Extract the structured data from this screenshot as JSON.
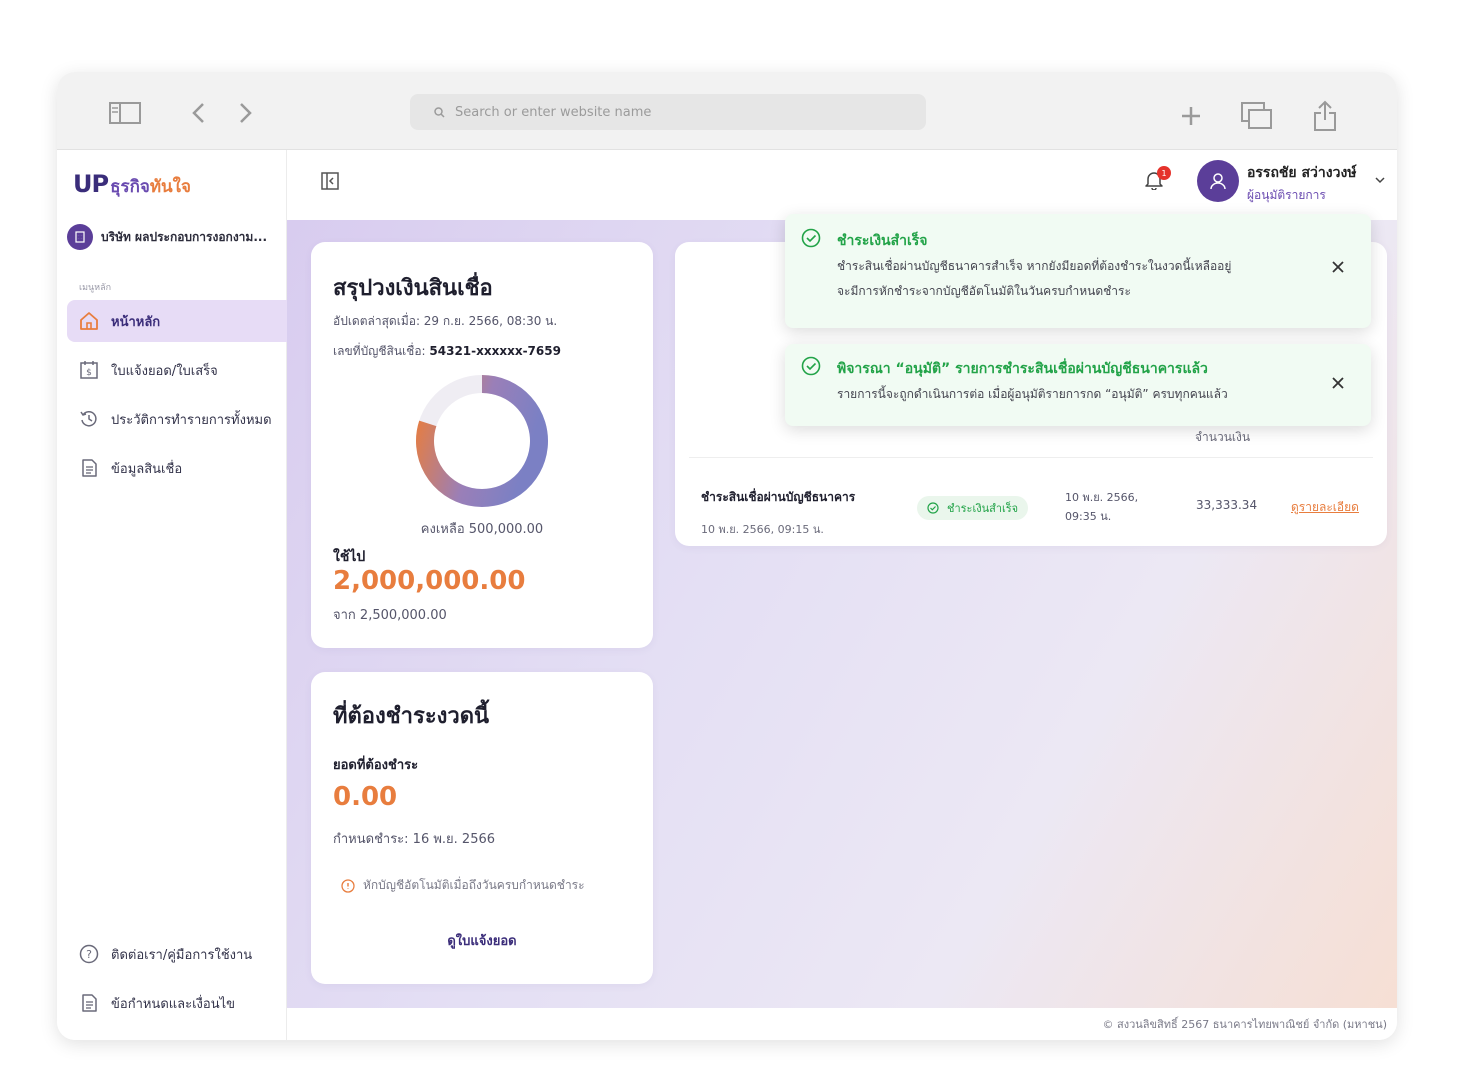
{
  "browser": {
    "search_placeholder": "Search or enter website name"
  },
  "brand": {
    "logo_mark_up": "UP",
    "logo_text_a": "ธุรกิจ",
    "logo_text_b": "ทันใจ"
  },
  "sidebar": {
    "company": "บริษัท ผลประกอบการงอกงาม...",
    "section_label": "เมนูหลัก",
    "items": [
      {
        "label": "หน้าหลัก",
        "icon": "home-icon",
        "active": true
      },
      {
        "label": "ใบแจ้งยอด/ใบเสร็จ",
        "icon": "receipt-icon"
      },
      {
        "label": "ประวัติการทำรายการทั้งหมด",
        "icon": "history-icon"
      },
      {
        "label": "ข้อมูลสินเชื่อ",
        "icon": "document-icon"
      }
    ],
    "bottom_items": [
      {
        "label": "ติดต่อเรา/คู่มือการใช้งาน",
        "icon": "help-icon"
      },
      {
        "label": "ข้อกำหนดและเงื่อนไข",
        "icon": "document-icon"
      }
    ]
  },
  "header": {
    "notification_count": "1",
    "user_name": "อรรถชัย สว่างวงษ์",
    "user_role": "ผู้อนุมัติรายการ"
  },
  "summary": {
    "title": "สรุปวงเงินสินเชื่อ",
    "updated": "อัปเดตล่าสุดเมื่อ: 29 ก.ย. 2566, 08:30 น.",
    "account_label": "เลขที่บัญชีสินเชื่อ: ",
    "account_number": "54321-xxxxxx-7659",
    "remaining": "คงเหลือ 500,000.00",
    "used_label": "ใช้ไป",
    "used_amount": "2,000,000.00",
    "total": "จาก 2,500,000.00",
    "used_fraction": 0.8
  },
  "due": {
    "title": "ที่ต้องชำระงวดนี้",
    "amount_label": "ยอดที่ต้องชำระ",
    "amount": "0.00",
    "due_date": "กำหนดชำระ: 16 พ.ย. 2566",
    "auto_debit_note": "หักบัญชีอัตโนมัติเมื่อถึงวันครบกำหนดชำระ",
    "view_statement": "ดูใบแจ้งยอด"
  },
  "table": {
    "amount_header": "จำนวนเงิน",
    "row": {
      "title": "ชำระสินเชื่อผ่านบัญชีธนาคาร",
      "datetime": "10 พ.ย. 2566, 09:15 น.",
      "status": "ชำระเงินสำเร็จ",
      "date_line1": "10 พ.ย. 2566,",
      "date_line2": "09:35 น.",
      "amount": "33,333.34",
      "details_link": "ดูรายละเอียด"
    }
  },
  "toasts": [
    {
      "title": "ชำระเงินสำเร็จ",
      "line1": "ชำระสินเชื่อผ่านบัญชีธนาคารสำเร็จ หากยังมียอดที่ต้องชำระในงวดนี้เหลืออยู่",
      "line2": "จะมีการหักชำระจากบัญชีอัตโนมัติในวันครบกำหนดชำระ"
    },
    {
      "title": "พิจารณา “อนุมัติ” รายการชำระสินเชื่อผ่านบัญชีธนาคารแล้ว",
      "line1": "รายการนี้จะถูกดำเนินการต่อ เมื่อผู้อนุมัติรายการกด “อนุมัติ” ครบทุกคนแล้ว"
    }
  ],
  "footer": {
    "copyright": "© สงวนลิขสิทธิ์ 2567 ธนาคารไทยพาณิชย์ จำกัด (มหาชน)"
  },
  "colors": {
    "brand_purple": "#5b3e99",
    "accent_orange": "#e87d3e",
    "success_green": "#22a348",
    "donut_used_start": "#e87d3e",
    "donut_used_end": "#7b80c4",
    "donut_remaining": "#efedf3"
  }
}
